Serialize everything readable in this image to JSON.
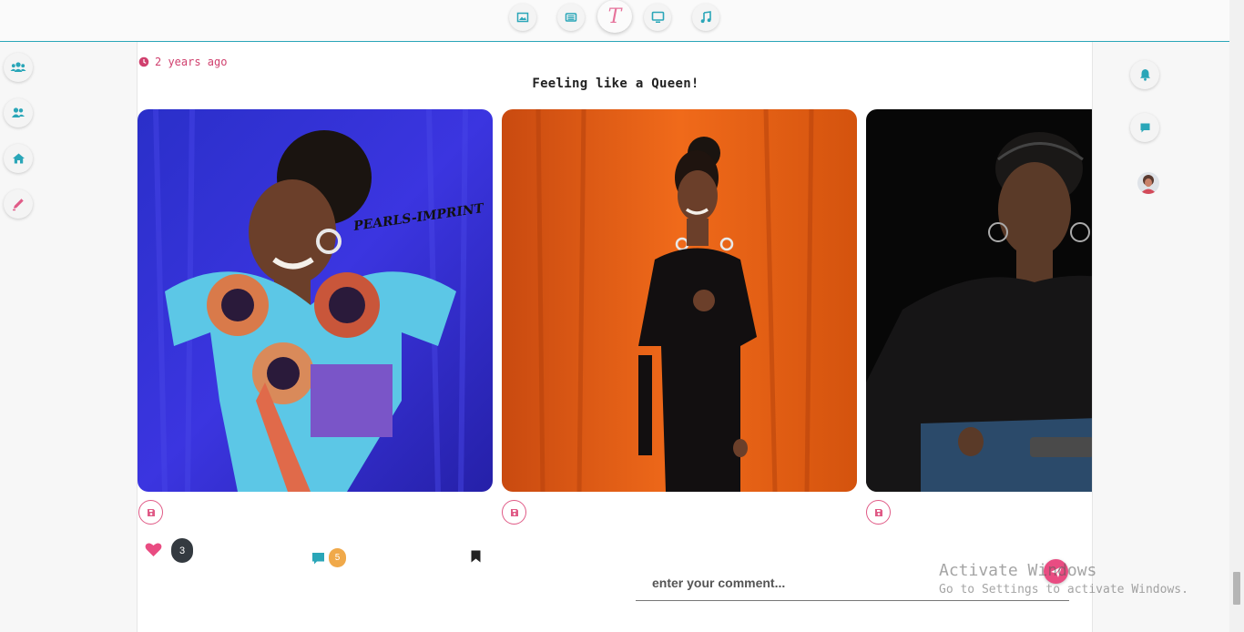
{
  "top_nav": {
    "items": [
      "gallery",
      "news",
      "logo",
      "tv",
      "music"
    ],
    "logo_letter": "T"
  },
  "left_rail": {
    "items": [
      "groups",
      "friends",
      "home",
      "write"
    ]
  },
  "right_rail": {
    "items": [
      "notifications",
      "messages",
      "profile"
    ]
  },
  "post": {
    "time_ago": "2 years ago",
    "caption": "Feeling like a Queen!",
    "photo_overlay_text": "PEARLS-IMPRINT",
    "like_count": "3",
    "comment_count": "5"
  },
  "comment": {
    "placeholder": "enter your comment..."
  },
  "watermark": {
    "line1": "Activate Windows",
    "line2": "Go to Settings to activate Windows."
  },
  "colors": {
    "accent_teal": "#2aa6b8",
    "accent_pink": "#e05a86",
    "badge_dark": "#343a40",
    "badge_orange": "#f0a94a"
  }
}
